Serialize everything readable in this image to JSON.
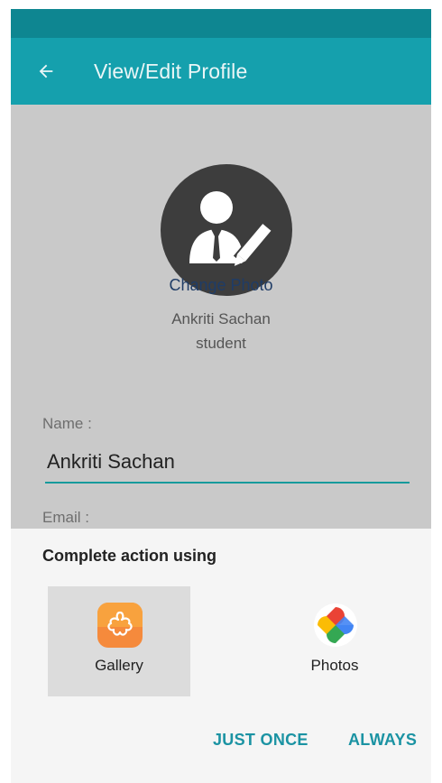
{
  "app_bar": {
    "title": "View/Edit Profile",
    "back_icon": "arrow-left-icon"
  },
  "profile": {
    "change_photo_label": "Change Photo",
    "name": "Ankriti Sachan",
    "role": "student",
    "avatar_icon": "user-edit-icon"
  },
  "form": {
    "name_label": "Name :",
    "name_value": "Ankriti Sachan",
    "email_label": "Email :"
  },
  "chooser": {
    "title": "Complete action using",
    "apps": [
      {
        "label": "Gallery",
        "icon": "gallery-icon",
        "selected": true
      },
      {
        "label": "Photos",
        "icon": "photos-icon",
        "selected": false
      }
    ],
    "just_once_label": "JUST ONCE",
    "always_label": "ALWAYS"
  },
  "colors": {
    "status_bar": "#0e8691",
    "app_bar": "#15a0ad",
    "accent": "#1b93a3",
    "link": "#1f3c66",
    "overlay_background": "#c9c9c9",
    "sheet_background": "#f5f5f5"
  }
}
